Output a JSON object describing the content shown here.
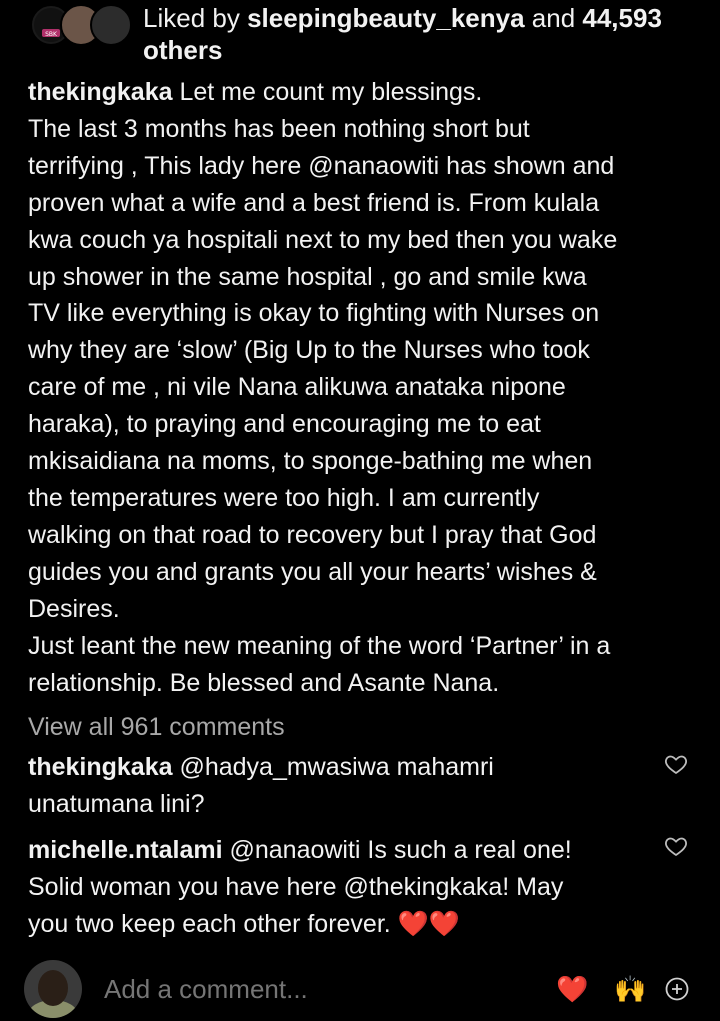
{
  "likes": {
    "prefix": "Liked by ",
    "user": "sleepingbeauty_kenya",
    "middle": " and ",
    "count": "44,593",
    "suffix": "others",
    "avatar_badge": "SBK"
  },
  "caption": {
    "username": "thekingkaka",
    "lines": [
      " Let me count my blessings.",
      "The last 3 months has been nothing short but",
      "terrifying , This lady here @nanaowiti has shown and",
      "proven what a wife and a best friend is. From kulala",
      "kwa couch ya hospitali next to my bed then you wake",
      "up shower in the same hospital , go and smile kwa",
      "TV like everything is okay to fighting with Nurses on",
      "why they are ‘slow’ (Big Up to the Nurses who took",
      "care of me ,  ni vile Nana alikuwa anataka nipone",
      "haraka), to praying and encouraging me to eat",
      "mkisaidiana na moms, to sponge-bathing me when",
      "the temperatures were too high. I am currently",
      "walking on that road to recovery but I pray that God",
      "guides you and grants you all your hearts’ wishes &",
      "Desires.",
      "Just leant the new meaning of the word ‘Partner’ in a",
      "relationship. Be blessed and Asante Nana."
    ]
  },
  "view_all_comments": "View all 961 comments",
  "comments": [
    {
      "username": "thekingkaka",
      "line1": " @hadya_mwasiwa mahamri",
      "line2": "unatumana lini?"
    },
    {
      "username": "michelle.ntalami",
      "line1": " @nanaowiti Is such a real one!",
      "line2": "Solid woman you have here @thekingkaka! May",
      "line3": "you two keep each other forever. ❤️❤️"
    }
  ],
  "add_comment": {
    "placeholder": "Add a comment...",
    "quick_emoji_1": "❤️",
    "quick_emoji_2": "🙌"
  },
  "icons": {
    "like": "heart-outline-icon",
    "add": "plus-circle-icon"
  },
  "colors": {
    "background": "#000000",
    "text": "#f2f2f2",
    "secondary_text": "#a8a8a8",
    "placeholder": "#8e8e8e"
  }
}
